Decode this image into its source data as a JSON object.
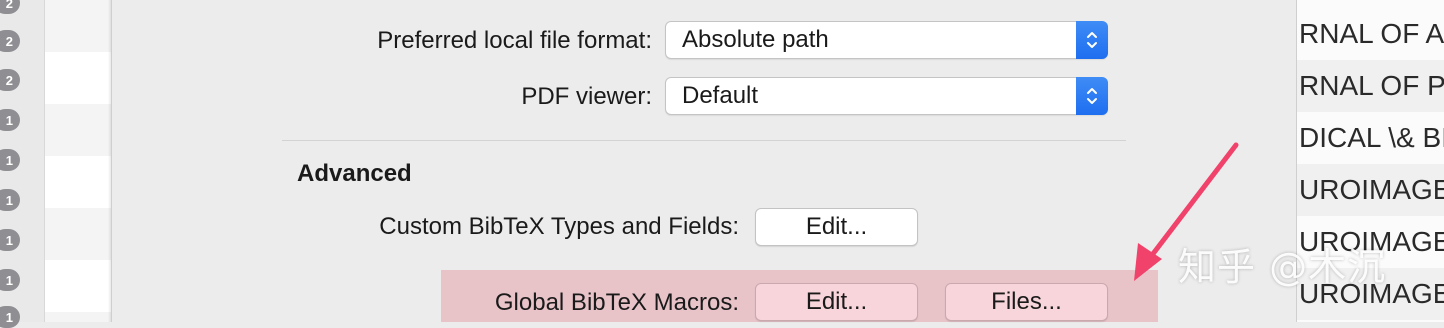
{
  "background_left": {
    "badges": [
      "2",
      "2",
      "2",
      "1",
      "1",
      "1",
      "1",
      "1",
      "1"
    ]
  },
  "background_right": {
    "rows": [
      "RNAL OF A",
      "RNAL OF P",
      "DICAL \\& BI",
      "UROIMAGE",
      "UROIMAGE",
      "UROIMAGE"
    ]
  },
  "dialog": {
    "local_file_format": {
      "label": "Preferred local file format:",
      "value": "Absolute path"
    },
    "pdf_viewer": {
      "label": "PDF viewer:",
      "value": "Default"
    },
    "advanced": {
      "title": "Advanced",
      "custom_types": {
        "label": "Custom BibTeX Types and Fields:",
        "button": "Edit..."
      },
      "global_macros": {
        "label": "Global BibTeX Macros:",
        "edit_button": "Edit...",
        "files_button": "Files..."
      }
    }
  },
  "annotation": {
    "arrow_color": "#f0426a",
    "highlight_color": "#e8c4c9"
  },
  "watermark": "知乎 @木沉"
}
